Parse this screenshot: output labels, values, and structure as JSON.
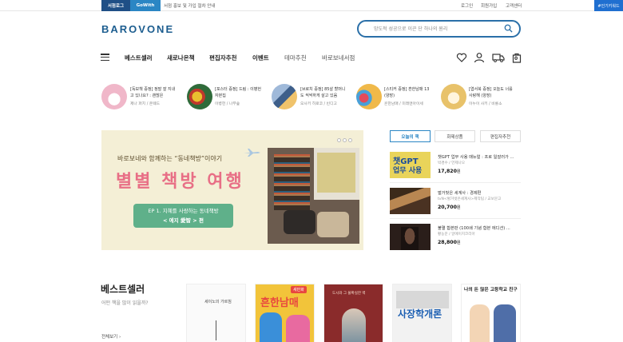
{
  "topbar": {
    "tab1": "서점로그",
    "tab2": "GoWith",
    "notice": "서점 홍보 및 가입 절차 안내",
    "links": [
      "로그인",
      "회원가입",
      "고객센터"
    ],
    "right": "#인기키워드"
  },
  "header": {
    "logo": "BAROVONE",
    "search_placeholder": "망도적 성공으로 이끈 단 하나의 원리"
  },
  "nav": {
    "items": [
      "베스트셀러",
      "새로나온책",
      "편집자추천",
      "이벤트",
      "테마추천",
      "바로보네서점"
    ],
    "cart_count": "0"
  },
  "recommendations": [
    {
      "title": "[독보책 증정] 정말 잘 지내고 있나요? : 괜찮은",
      "author": "제나 퍼치 / 온웨드"
    },
    {
      "title": "[포스터 증정] 드림 : 이병헌 자본집",
      "author": "이병헌 / 나무숲"
    },
    {
      "title": "[브로치 증정] 85살 할머니도 씩씩하게 살고 있음",
      "author": "오사키 히로코 / 빈디고"
    },
    {
      "title": "[스티커 증정] 흔한남매 13 (양장)",
      "author": "흔한남매 / 미래엔아이세"
    },
    {
      "title": "[엽서북 증정] 오늘도 너를 사랑해 (양장)",
      "author": "이누이 사키 / 비룡소"
    }
  ],
  "banner": {
    "subtitle": "바로보네와 함께하는 “동네책방”이야기",
    "title": "별별 책방 여행",
    "pill_line1": "EP 1. 지혜를 사랑하는 동네책방",
    "pill_line2": "< 에지 愛智 > 편"
  },
  "side": {
    "tabs": [
      "오늘의 책",
      "화제상품",
      "편집자추천"
    ],
    "books": [
      {
        "cover_top": "챗GPT",
        "cover_bottom": "업무 사용",
        "title": "챗GPT 업무 사용 매뉴얼 : 프로 일잘러가 ...",
        "author": "박경수 / 언제나오",
        "price": "17,820",
        "unit": "원"
      },
      {
        "title": "벌거벗은 세계사 : 경제편",
        "author": "tvN<벌거벗은세계사>제작팀 / 교보문고",
        "price": "20,700",
        "unit": "원"
      },
      {
        "title": "불멸 합본판 (100쇄 기념 합본 에디션) ...",
        "author": "황농문 / 알에이치코리아",
        "price": "28,800",
        "unit": "원"
      }
    ]
  },
  "bestseller": {
    "heading": "베스트셀러",
    "sub": "어떤 책을 많이 읽을까?",
    "more": "전체보기 ›",
    "books": [
      {
        "label": "세이노의 가르침"
      },
      {
        "label": "흔한남매",
        "badge": "새만화"
      },
      {
        "label": "도시와 그 불확실한 벽"
      },
      {
        "label": "사장학개론"
      },
      {
        "label": "나의 돈 많은 고등학교 친구"
      }
    ]
  },
  "colors": {
    "brand": "#1c5d8f",
    "accent": "#2b86c4",
    "banner_pink": "#e86f86",
    "banner_green": "#5fb08a"
  }
}
